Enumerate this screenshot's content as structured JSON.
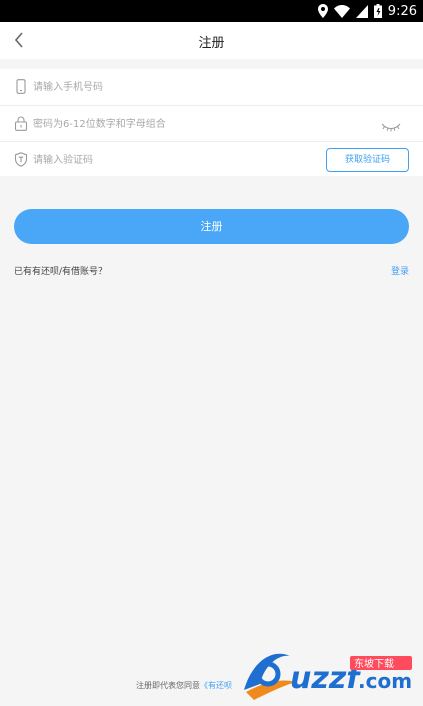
{
  "status_bar": {
    "time": "9:26",
    "icons": [
      "location-icon",
      "wifi-icon",
      "signal-icon",
      "battery-icon"
    ]
  },
  "nav": {
    "title": "注册",
    "back_icon": "chevron-left-icon"
  },
  "form": {
    "phone": {
      "placeholder": "请输入手机号码",
      "value": "",
      "icon": "phone-icon"
    },
    "password": {
      "placeholder": "密码为6-12位数字和字母组合",
      "value": "",
      "icon": "lock-icon",
      "toggle_icon": "eye-closed-icon"
    },
    "code": {
      "placeholder": "请输入验证码",
      "value": "",
      "icon": "shield-icon",
      "button_label": "获取验证码"
    }
  },
  "submit_label": "注册",
  "have_account_text": "已有有还呗/有借账号？",
  "login_label": "登录",
  "agreement": {
    "prefix": "注册即代表您同意",
    "link": "《有还呗"
  },
  "watermark": {
    "brand": "uzzf.com",
    "tag": "东坡下载"
  },
  "colors": {
    "accent": "#4aa7f7",
    "link": "#3ea0f5",
    "background": "#f5f5f5"
  }
}
